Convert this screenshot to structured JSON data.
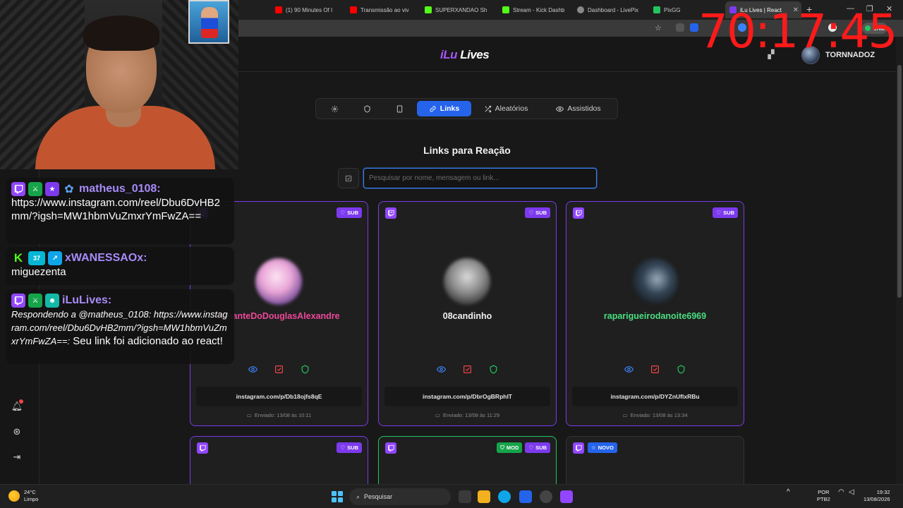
{
  "browser": {
    "tabs": [
      {
        "label": "(1) 90 Minutes Of I",
        "color": "#ff0000"
      },
      {
        "label": "Transmissão ao viv",
        "color": "#ff0000"
      },
      {
        "label": "SUPERXANDAO Sh",
        "color": "#53fc18"
      },
      {
        "label": "Stream - Kick Dashb",
        "color": "#53fc18"
      },
      {
        "label": "Dashboard - LivePix",
        "color": "#888888"
      },
      {
        "label": "PixGG",
        "color": "#22c55e"
      },
      {
        "label": "iLu Lives | React",
        "color": "#7c3aed"
      }
    ],
    "chat_chip": "Chat"
  },
  "app": {
    "logo_prefix": "iLu",
    "logo_suffix": " Lives",
    "user_name": "TORNNADOZ",
    "nav_tabs": [
      {
        "label": "",
        "icon": "gear-icon"
      },
      {
        "label": "",
        "icon": "shield-icon"
      },
      {
        "label": "",
        "icon": "tablet-icon"
      },
      {
        "label": "Links",
        "icon": "link-icon",
        "active": true
      },
      {
        "label": "Aleatórios",
        "icon": "shuffle-icon"
      },
      {
        "label": "Assistidos",
        "icon": "eye-icon"
      }
    ],
    "section_title": "Links para Reação",
    "search_placeholder": "Pesquisar por nome, mensagem ou link...",
    "cards": [
      {
        "name": "AmanteDoDouglasAlexandre",
        "name_color": "#ec4899",
        "tags": [
          "SUB"
        ],
        "link": "instagram.com/p/Db18ojfs8qE",
        "date": "Enviado: 13/08 às 10:11",
        "border": "sub"
      },
      {
        "name": "08candinho",
        "name_color": "#f1f1f1",
        "tags": [
          "SUB"
        ],
        "link": "instagram.com/p/DbrOgBRphIT",
        "date": "Enviado: 13/08 às 11:29",
        "border": "sub"
      },
      {
        "name": "raparigueirodanoite6969",
        "name_color": "#4ade80",
        "tags": [
          "SUB"
        ],
        "link": "instagram.com/p/DYZnUflxRBu",
        "date": "Enviado: 13/08 às 13:34",
        "border": "sub"
      },
      {
        "name": "",
        "tags": [
          "SUB"
        ],
        "border": "sub"
      },
      {
        "name": "",
        "tags": [
          "MOD",
          "SUB"
        ],
        "border": "mod"
      },
      {
        "name": "",
        "tags": [
          "NOVO"
        ],
        "border": "plain"
      }
    ]
  },
  "overlay": {
    "timer": "70:17:45",
    "chat": [
      {
        "user": "matheus_0108:",
        "user_color": "#a78bfa",
        "message": "https://www.instagram.com/reel/Dbu6DvHB2mm/?igsh=MW1hbmVuZmxrYmFwZA=="
      },
      {
        "user": "xWANESSAOx:",
        "user_color": "#a78bfa",
        "badge_num": "37",
        "message": "miguezenta"
      },
      {
        "user": "iLuLives:",
        "user_color": "#a78bfa",
        "reply": "Respondendo a @matheus_0108: https://www.instagram.com/reel/Dbu6DvHB2mm/?igsh=MW1hbmVuZmxrYmFwZA==:",
        "message": " Seu link foi adicionado ao react!"
      }
    ]
  },
  "taskbar": {
    "temp": "24°C",
    "weather": "Limpo",
    "search": "Pesquisar",
    "lang": "POR",
    "layout": "PTB2",
    "time": "19:32",
    "date": "13/08/2026"
  }
}
